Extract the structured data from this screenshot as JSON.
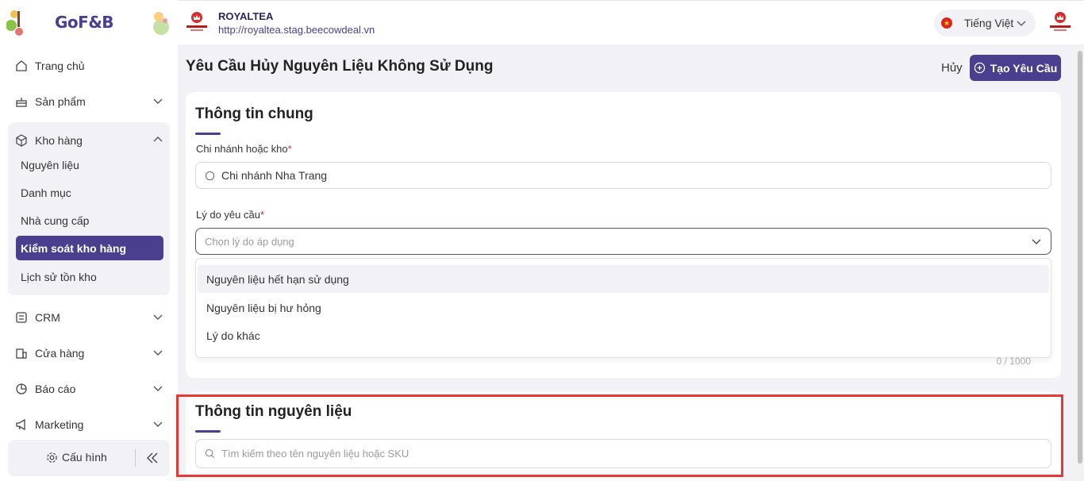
{
  "app": {
    "logo_text": "GoF&B"
  },
  "sidebar": {
    "items": [
      {
        "label": "Trang chủ",
        "icon": "home-icon"
      },
      {
        "label": "Sản phẩm",
        "icon": "cake-icon"
      },
      {
        "label": "Kho hàng",
        "icon": "box-icon"
      },
      {
        "label": "CRM",
        "icon": "list-icon"
      },
      {
        "label": "Cửa hàng",
        "icon": "store-icon"
      },
      {
        "label": "Báo cáo",
        "icon": "pie-chart-icon"
      },
      {
        "label": "Marketing",
        "icon": "megaphone-icon"
      }
    ],
    "warehouse_sub": [
      {
        "label": "Nguyên liệu"
      },
      {
        "label": "Danh mục"
      },
      {
        "label": "Nhà cung cấp"
      },
      {
        "label": "Kiểm soát kho hàng",
        "active": true
      },
      {
        "label": "Lịch sử tồn kho"
      }
    ],
    "footer": {
      "config_label": "Cấu hình"
    }
  },
  "header": {
    "store_name": "ROYALTEA",
    "store_url": "http://royaltea.stag.beecowdeal.vn",
    "language": "Tiếng Việt"
  },
  "page": {
    "title": "Yêu Cầu Hủy Nguyên Liệu Không Sử Dụng",
    "cancel_label": "Hủy",
    "create_label": "Tạo Yêu Cầu"
  },
  "general": {
    "title": "Thông tin chung",
    "branch_label": "Chi nhánh hoặc kho",
    "branch_value": "Chi nhánh Nha Trang",
    "reason_label": "Lý do yêu cầu",
    "reason_placeholder": "Chọn lý do áp dụng",
    "reason_options": [
      "Nguyên liệu hết hạn sử dụng",
      "Nguyên liệu bị hư hỏng",
      "Lý do khác"
    ],
    "note_counter": "0 / 1000"
  },
  "ingredients": {
    "title": "Thông tin nguyên liệu",
    "search_placeholder": "Tìm kiếm theo tên nguyên liệu hoặc SKU"
  },
  "colors": {
    "accent": "#4a3e8e",
    "background": "#f2f2f6",
    "highlight": "#e53935"
  }
}
